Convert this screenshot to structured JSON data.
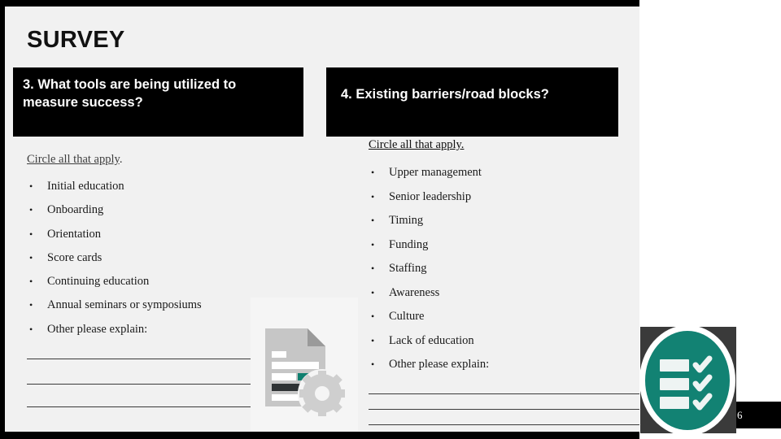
{
  "slide": {
    "title": "SURVEY",
    "page_number": "6",
    "accent_color": "#128273",
    "header_background": "#000000",
    "slide_background": "#f1f1f1"
  },
  "questions": [
    {
      "heading": "3. What tools are being utilized to measure success?",
      "instruction_text": "Circle all that apply",
      "instruction_period": ".",
      "options": [
        "Initial education",
        "Onboarding",
        "Orientation",
        "Score cards",
        "Continuing education",
        "Annual seminars or symposiums",
        "Other please explain:"
      ],
      "write_in_lines": 3
    },
    {
      "heading": "4. Existing barriers/road blocks?",
      "instruction_text": "Circle all that apply.",
      "instruction_period": "",
      "options": [
        "Upper management",
        "Senior leadership",
        "Timing",
        "Funding",
        "Staffing",
        "Awareness",
        "Culture",
        "Lack of education",
        "Other please explain:"
      ],
      "write_in_lines": 3
    }
  ],
  "icons": {
    "document_gear": "document-gear-icon",
    "brand_checklist": "checklist-icon"
  }
}
